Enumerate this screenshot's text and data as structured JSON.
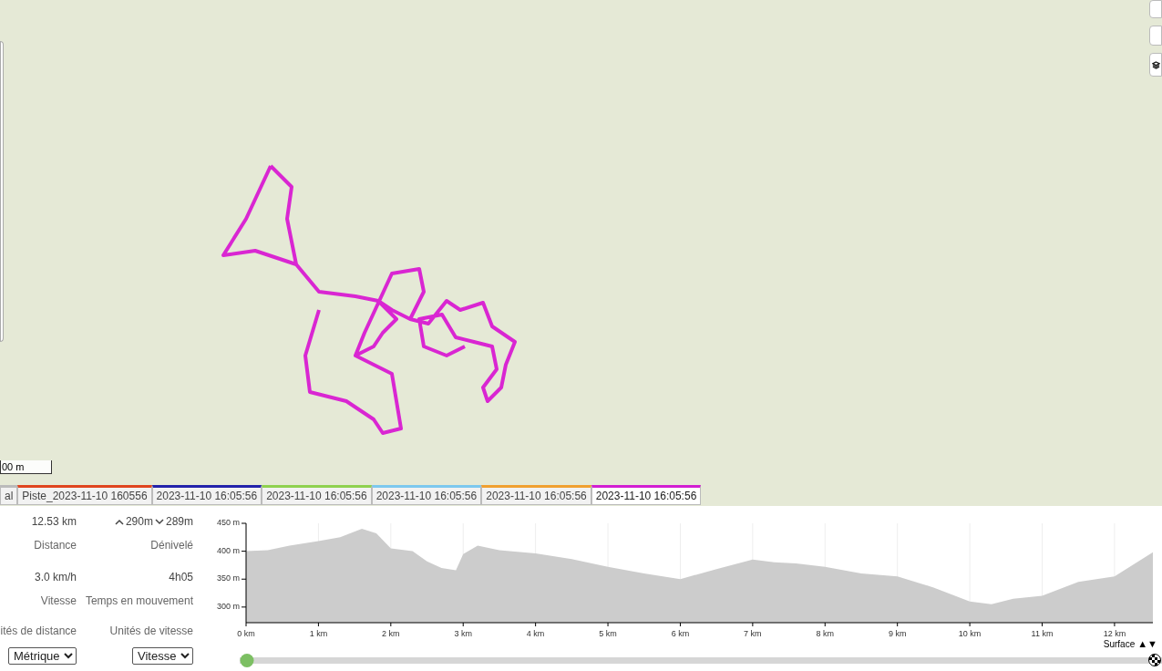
{
  "map": {
    "scale_label": "00 m"
  },
  "tabs": [
    {
      "label": "al",
      "selected": false
    },
    {
      "label": "Piste_2023-11-10 160556",
      "color": "#e0451f",
      "selected": false
    },
    {
      "label": "2023-11-10 16:05:56",
      "color": "#2222aa",
      "selected": false
    },
    {
      "label": "2023-11-10 16:05:56",
      "color": "#8fd14f",
      "selected": false
    },
    {
      "label": "2023-11-10 16:05:56",
      "color": "#7cc8ee",
      "selected": false
    },
    {
      "label": "2023-11-10 16:05:56",
      "color": "#f0a030",
      "selected": false
    },
    {
      "label": "2023-11-10 16:05:56",
      "color": "#d21fd2",
      "selected": true
    }
  ],
  "stats": [
    {
      "value": "12.53 km",
      "label": "Distance"
    },
    {
      "kind": "elevation",
      "up": "290m",
      "down": "289m",
      "label": "Dénivelé"
    },
    {
      "value": "3.0 km/h",
      "label": "Vitesse"
    },
    {
      "value": "4h05",
      "label": "Temps en mouvement"
    }
  ],
  "units": [
    {
      "label": "ités de distance",
      "selected_option": "Métrique"
    },
    {
      "label": "Unités de vitesse",
      "selected_option": "Vitesse"
    }
  ],
  "chart_data": {
    "type": "area",
    "x": [
      0,
      0.3,
      0.6,
      1,
      1.3,
      1.6,
      1.8,
      2,
      2.3,
      2.5,
      2.7,
      2.9,
      3,
      3.2,
      3.5,
      4,
      4.5,
      5,
      5.5,
      6,
      6.5,
      7,
      7.3,
      7.6,
      8,
      8.5,
      9,
      9.5,
      10,
      10.3,
      10.6,
      11,
      11.5,
      12,
      12.53
    ],
    "grid": true,
    "series": [
      {
        "color": "#cccccc",
        "values": [
          400,
          402,
          410,
          418,
          425,
          440,
          432,
          405,
          400,
          382,
          370,
          366,
          395,
          410,
          402,
          396,
          386,
          372,
          360,
          350,
          368,
          385,
          380,
          378,
          372,
          360,
          355,
          335,
          310,
          305,
          315,
          320,
          345,
          355,
          398
        ]
      }
    ],
    "xlim": [
      0,
      12.53
    ],
    "ylim": [
      272,
      450
    ],
    "xticks": [
      {
        "value": 0,
        "label": "0 km"
      },
      {
        "value": 1,
        "label": "1 km"
      },
      {
        "value": 2,
        "label": "2 km"
      },
      {
        "value": 3,
        "label": "3 km"
      },
      {
        "value": 4,
        "label": "4 km"
      },
      {
        "value": 5,
        "label": "5 km"
      },
      {
        "value": 6,
        "label": "6 km"
      },
      {
        "value": 7,
        "label": "7 km"
      },
      {
        "value": 8,
        "label": "8 km"
      },
      {
        "value": 9,
        "label": "9 km"
      },
      {
        "value": 10,
        "label": "10 km"
      },
      {
        "value": 11,
        "label": "11 km"
      },
      {
        "value": 12,
        "label": "12 km"
      }
    ],
    "yticks": [
      {
        "value": 300,
        "label": "300 m"
      },
      {
        "value": 350,
        "label": "350 m"
      },
      {
        "value": 400,
        "label": "400 m"
      },
      {
        "value": 450,
        "label": "450 m"
      }
    ]
  },
  "overlay": {
    "label": "Surface",
    "arrows": "▲▼"
  },
  "slider": {
    "level": 0
  }
}
